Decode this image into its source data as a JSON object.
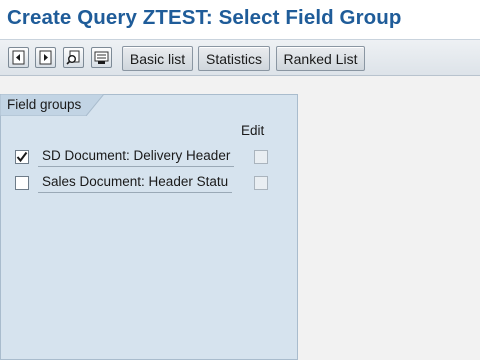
{
  "window": {
    "title": "Create Query ZTEST: Select Field Group"
  },
  "toolbar": {
    "icons": [
      "previous-icon",
      "next-icon",
      "find-icon",
      "layout-icon"
    ],
    "buttons": {
      "basic_list": "Basic list",
      "statistics": "Statistics",
      "ranked_list": "Ranked List"
    }
  },
  "field_groups": {
    "tab_label": "Field groups",
    "column_header": "Edit",
    "rows": [
      {
        "label": "SD Document: Delivery Header",
        "selected": true,
        "edit": false
      },
      {
        "label": "Sales Document: Header Statu",
        "selected": false,
        "edit": false
      }
    ]
  },
  "colors": {
    "title": "#1f5c99",
    "panel": "#d6e3ee",
    "background": "#f2f2f2"
  }
}
